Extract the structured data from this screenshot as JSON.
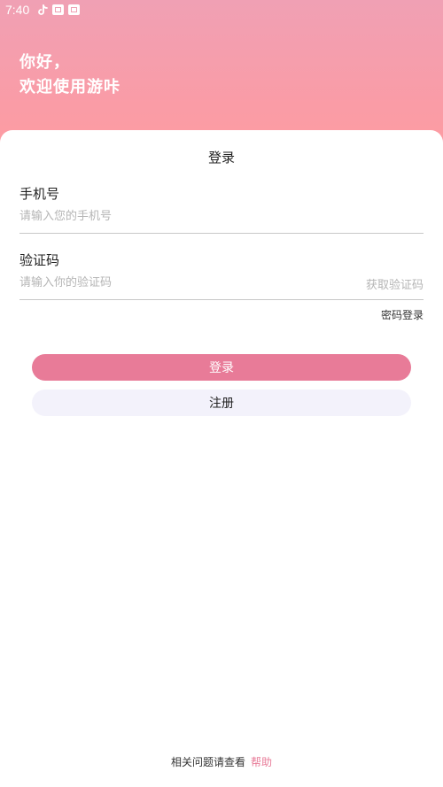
{
  "status_bar": {
    "time": "7:40",
    "icons": [
      "tiktok-icon",
      "app-icon",
      "app-icon"
    ]
  },
  "header": {
    "greeting_line1": "你好，",
    "greeting_line2": "欢迎使用游咔"
  },
  "login_card": {
    "title": "登录",
    "phone": {
      "label": "手机号",
      "placeholder": "请输入您的手机号",
      "value": ""
    },
    "code": {
      "label": "验证码",
      "placeholder": "请输入你的验证码",
      "value": "",
      "get_code_label": "获取验证码"
    },
    "password_login_label": "密码登录",
    "login_button_label": "登录",
    "register_button_label": "注册"
  },
  "footer": {
    "text": "相关问题请查看",
    "help_link": "帮助"
  },
  "colors": {
    "accent": "#e87b98",
    "header_gradient_top": "#f0a0b4",
    "header_gradient_bottom": "#ff9ba0",
    "register_button_bg": "#f3f2fb",
    "placeholder": "#b5b5b5"
  }
}
